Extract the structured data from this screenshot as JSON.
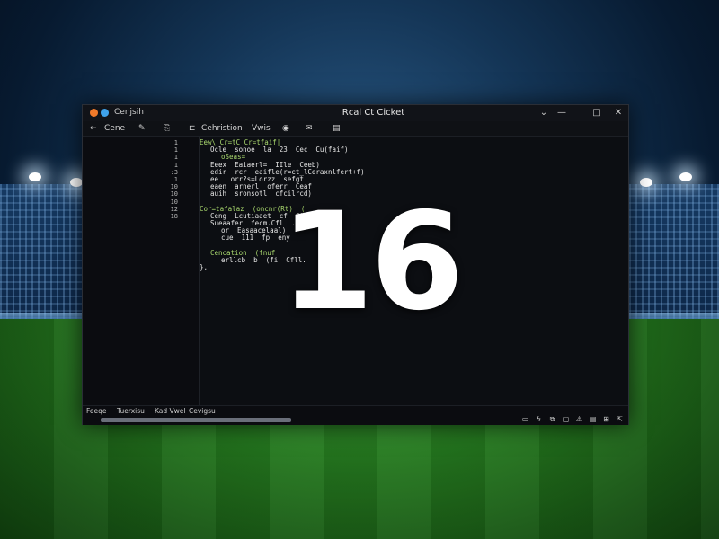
{
  "window": {
    "app_name": "Cenjsih",
    "title": "Rcal Ct Cicket",
    "controls": {
      "menu": "⌄",
      "minimize": "—",
      "maximize": "□",
      "close": "✕"
    }
  },
  "toolbar": {
    "back_label": "Cene",
    "items": [
      "Cehristion",
      "Vwis"
    ]
  },
  "line_numbers": [
    "1",
    "1",
    "1",
    "1",
    ":3",
    "1",
    "10",
    "10",
    "10",
    "12",
    "18"
  ],
  "code_lines": [
    {
      "indent": 0,
      "text": "Eew\\ Cr=tC Cr=tfaif|",
      "color": "#a9d86e"
    },
    {
      "indent": 2,
      "text": "Ocle  sonoe  la  23  Cec  Cu(faif)",
      "color": "#e6e6e6"
    },
    {
      "indent": 4,
      "text": "oSeas=",
      "color": "#a9d86e"
    },
    {
      "indent": 2,
      "text": "Eeex  Eaiaerl=  IIle  Ceeb)",
      "color": "#e6e6e6"
    },
    {
      "indent": 2,
      "text": "edir  rcr  eaifle(r=ct_lCeraxnlfert+f)",
      "color": "#e6e6e6"
    },
    {
      "indent": 2,
      "text": "ee   orr?s=Lorzz  sefgt",
      "color": "#e6e6e6"
    },
    {
      "indent": 2,
      "text": "eaen  arnerl  oferr  Ceaf",
      "color": "#e6e6e6"
    },
    {
      "indent": 2,
      "text": "auih  sronsotl  cfcilrcd)",
      "color": "#e6e6e6"
    },
    {
      "indent": 0,
      "text": "",
      "color": "#e6e6e6"
    },
    {
      "indent": 0,
      "text": "Cor=tafalaz  (oncnr(Rt)  (",
      "color": "#a9d86e"
    },
    {
      "indent": 2,
      "text": "Ceng  Lcutiaaet  cf  Cilrce",
      "color": "#e6e6e6"
    },
    {
      "indent": 2,
      "text": "Sueaafer  fecm.Cfl  .",
      "color": "#e6e6e6"
    },
    {
      "indent": 4,
      "text": "or  Easaacelaal)",
      "color": "#e6e6e6"
    },
    {
      "indent": 4,
      "text": "cue  111  fp  eny",
      "color": "#e6e6e6"
    },
    {
      "indent": 0,
      "text": "",
      "color": "#e6e6e6"
    },
    {
      "indent": 2,
      "text": "Cencation  (fnuf",
      "color": "#a9d86e"
    },
    {
      "indent": 4,
      "text": "erllcb  b  (fi  Cfll.",
      "color": "#e6e6e6"
    },
    {
      "indent": 0,
      "text": "},",
      "color": "#e6e6e6"
    }
  ],
  "overlay_number": "16",
  "status": {
    "tabs": [
      "Feeqe",
      "Tuerxisu",
      "Kad Vwel",
      "Cevigsu"
    ],
    "scroll": {
      "fraction": 1.0
    },
    "icons": [
      "stack-icon",
      "lightning-icon",
      "layers-icon",
      "box-icon",
      "warning-icon",
      "clipboard-icon",
      "grid-icon",
      "exit-icon"
    ]
  },
  "colors": {
    "code_keyword": "#a9d86e",
    "code_text": "#e6e6e6",
    "window_bg": "#0c0e12",
    "accent_orange": "#f07a2a",
    "accent_blue": "#3fa2ea"
  }
}
